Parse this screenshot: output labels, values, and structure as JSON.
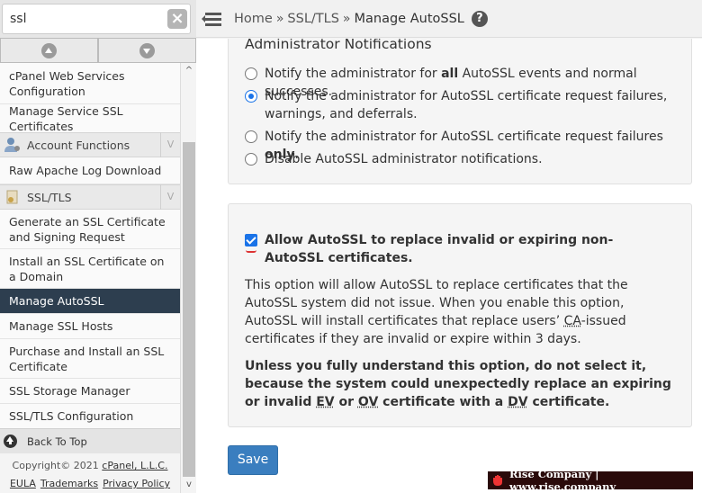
{
  "search": {
    "value": "ssl"
  },
  "sidebar": {
    "items": [
      {
        "label": "cPanel Web Services Configuration"
      },
      {
        "label": "Manage Service SSL Certificates"
      },
      {
        "label": "Raw Apache Log Download"
      },
      {
        "label": "Generate an SSL Certificate and Signing Request"
      },
      {
        "label": "Install an SSL Certificate on a Domain"
      },
      {
        "label": "Manage AutoSSL"
      },
      {
        "label": "Manage SSL Hosts"
      },
      {
        "label": "Purchase and Install an SSL Certificate"
      },
      {
        "label": "SSL Storage Manager"
      },
      {
        "label": "SSL/TLS Configuration"
      }
    ],
    "groups": [
      {
        "label": "Account Functions"
      },
      {
        "label": "SSL/TLS"
      }
    ],
    "back_to_top": "Back To Top",
    "footer": {
      "copyright_prefix": "Copyright© 2021",
      "copyright_link": "cPanel, L.L.C.",
      "eula": "EULA",
      "trademarks": "Trademarks",
      "privacy": "Privacy Policy"
    }
  },
  "header": {
    "breadcrumbs": [
      "Home",
      "SSL/TLS",
      "Manage AutoSSL"
    ],
    "separator": "»",
    "help": "?"
  },
  "notifications": {
    "title": "Administrator Notifications",
    "options": [
      {
        "pre": "Notify the administrator for ",
        "bold": "all",
        "post": " AutoSSL events and normal successes.",
        "checked": false
      },
      {
        "pre": "Notify the administrator for AutoSSL certificate request failures, warnings, and deferrals.",
        "bold": "",
        "post": "",
        "checked": true
      },
      {
        "pre": "Notify the administrator for AutoSSL certificate request failures ",
        "bold": "only",
        "post": ".",
        "checked": false
      },
      {
        "pre": "Disable AutoSSL administrator notifications.",
        "bold": "",
        "post": "",
        "checked": false
      }
    ]
  },
  "replace_option": {
    "label": "Allow AutoSSL to replace invalid or expiring non-AutoSSL certificates.",
    "checked": true,
    "desc_1": "This option will allow AutoSSL to replace certificates that the AutoSSL system did not issue. When you enable this option, AutoSSL will install certificates that replace users’",
    "ca": "CA",
    "desc_2": "-issued certificates if they are invalid or expire within 3 days.",
    "warn_1": "Unless you fully understand this option, do not select it, because the system could unexpectedly replace an expiring or invalid",
    "ev": "EV",
    "or": "or",
    "ov": "OV",
    "warn_2": "certificate with a",
    "dv": "DV",
    "warn_3": "certificate."
  },
  "save_label": "Save",
  "watermark": "Rise Company | www.rise.company",
  "colors": {
    "active_nav": "#2d3e4f",
    "primary": "#3a7ebf",
    "check": "#1a73e8"
  }
}
